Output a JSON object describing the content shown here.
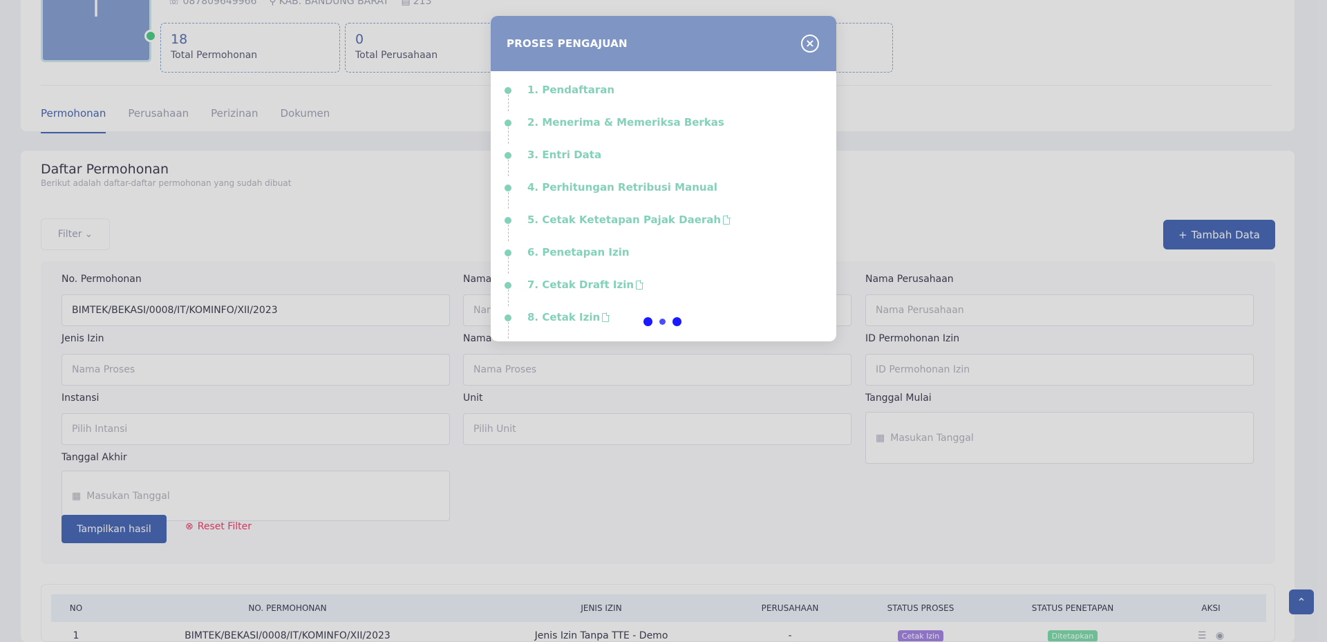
{
  "profile": {
    "avatar_letter": "I",
    "phone": "087809649966",
    "location": "KAB. BANDUNG BARAT",
    "count": "213"
  },
  "stats": [
    {
      "value": "18",
      "label": "Total Permohonan"
    },
    {
      "value": "0",
      "label": "Total Perusahaan"
    }
  ],
  "tabs": [
    "Permohonan",
    "Perusahaan",
    "Perizinan",
    "Dokumen"
  ],
  "section": {
    "title": "Daftar Permohonan",
    "subtitle": "Berikut adalah daftar-daftar permohonan yang sudah dibuat",
    "filter_label": "Filter",
    "add_label": "Tambah Data"
  },
  "filters": {
    "no_permohonan": {
      "label": "No. Permohonan",
      "value": "BIMTEK/BEKASI/0008/IT/KOMINFO/XII/2023"
    },
    "nama": {
      "label": "Nama",
      "placeholder": "Nar"
    },
    "nama_perusahaan": {
      "label": "Nama Perusahaan",
      "placeholder": "Nama Perusahaan"
    },
    "jenis_izin": {
      "label": "Jenis Izin",
      "placeholder": "Nama Proses"
    },
    "nama_proses": {
      "label": "Nama Proses",
      "placeholder": "Nama Proses"
    },
    "id_permohonan": {
      "label": "ID Permohonan Izin",
      "placeholder": "ID Permohonan Izin"
    },
    "instansi": {
      "label": "Instansi",
      "placeholder": "Pilih Intansi"
    },
    "unit": {
      "label": "Unit",
      "placeholder": "Pilih Unit"
    },
    "tanggal_mulai": {
      "label": "Tanggal Mulai",
      "placeholder": "Masukan Tanggal"
    },
    "tanggal_akhir": {
      "label": "Tanggal Akhir",
      "placeholder": "Masukan Tanggal"
    },
    "show_label": "Tampilkan hasil",
    "reset_label": "Reset Filter"
  },
  "table": {
    "headers": [
      "NO",
      "NO. PERMOHONAN",
      "JENIS IZIN",
      "PERUSAHAAN",
      "STATUS PROSES",
      "STATUS PENETAPAN",
      "AKSI"
    ],
    "rows": [
      {
        "no": "1",
        "no_permohonan": "BIMTEK/BEKASI/0008/IT/KOMINFO/XII/2023",
        "jenis_izin": "Jenis Izin Tanpa TTE - Demo",
        "perusahaan": "-",
        "status_proses": "Cetak Izin",
        "status_penetapan": "Ditetapkan"
      }
    ]
  },
  "modal": {
    "title": "PROSES PENGAJUAN",
    "steps": [
      {
        "label": "1. Pendaftaran",
        "doc": false
      },
      {
        "label": "2. Menerima & Memeriksa Berkas",
        "doc": false
      },
      {
        "label": "3. Entri Data",
        "doc": false
      },
      {
        "label": "4. Perhitungan Retribusi Manual",
        "doc": false
      },
      {
        "label": "5. Cetak Ketetapan Pajak Daerah",
        "doc": true
      },
      {
        "label": "6. Penetapan Izin",
        "doc": false
      },
      {
        "label": "7. Cetak Draft Izin",
        "doc": true
      },
      {
        "label": "8. Cetak Izin",
        "doc": true
      }
    ]
  },
  "colors": {
    "accent": "#4b6bb8",
    "modal_header": "#7f96c4",
    "step_green": "#84d1ba",
    "loader_blue": "#1a1aff",
    "badge_purple": "#7239ea",
    "badge_green": "#50cd89",
    "danger": "#f1416c"
  }
}
